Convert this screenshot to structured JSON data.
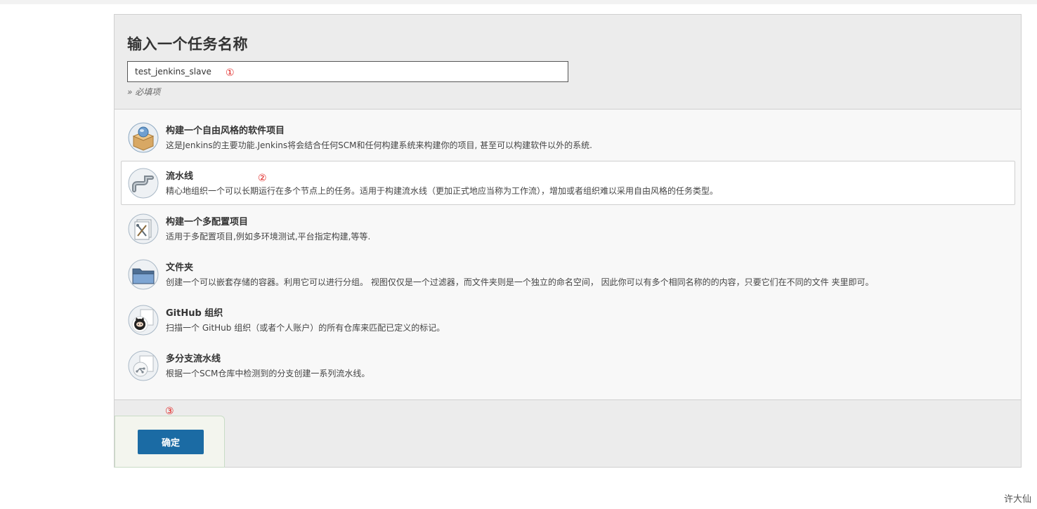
{
  "form": {
    "heading": "输入一个任务名称",
    "name_value": "test_jenkins_slave",
    "required_note": "» 必填项"
  },
  "annotations": {
    "step1": "①",
    "step2": "②",
    "step3": "③"
  },
  "item_types": [
    {
      "title": "构建一个自由风格的软件项目",
      "description": "这是Jenkins的主要功能.Jenkins将会结合任何SCM和任何构建系统来构建你的项目, 甚至可以构建软件以外的系统.",
      "icon": "freestyle-package-icon"
    },
    {
      "title": "流水线",
      "description": "精心地组织一个可以长期运行在多个节点上的任务。适用于构建流水线（更加正式地应当称为工作流），增加或者组织难以采用自由风格的任务类型。",
      "icon": "pipeline-pipe-icon",
      "selected": true
    },
    {
      "title": "构建一个多配置项目",
      "description": "适用于多配置项目,例如多环境测试,平台指定构建,等等.",
      "icon": "multi-config-tools-icon"
    },
    {
      "title": "文件夹",
      "description": "创建一个可以嵌套存储的容器。利用它可以进行分组。 视图仅仅是一个过滤器，而文件夹则是一个独立的命名空间， 因此你可以有多个相同名称的的内容，只要它们在不同的文件 夹里即可。",
      "icon": "folder-icon"
    },
    {
      "title": "GitHub 组织",
      "description": "扫描一个 GitHub 组织（或者个人账户）的所有仓库来匹配已定义的标记。",
      "icon": "github-octocat-icon"
    },
    {
      "title": "多分支流水线",
      "description": "根据一个SCM仓库中检测到的分支创建一系列流水线。",
      "icon": "multibranch-pipeline-icon"
    }
  ],
  "actions": {
    "ok_label": "确定"
  },
  "watermark": "许大仙",
  "colors": {
    "ok_button": "#1b6ba4",
    "annotation": "#e0201e",
    "panel_bg": "#ececec"
  }
}
